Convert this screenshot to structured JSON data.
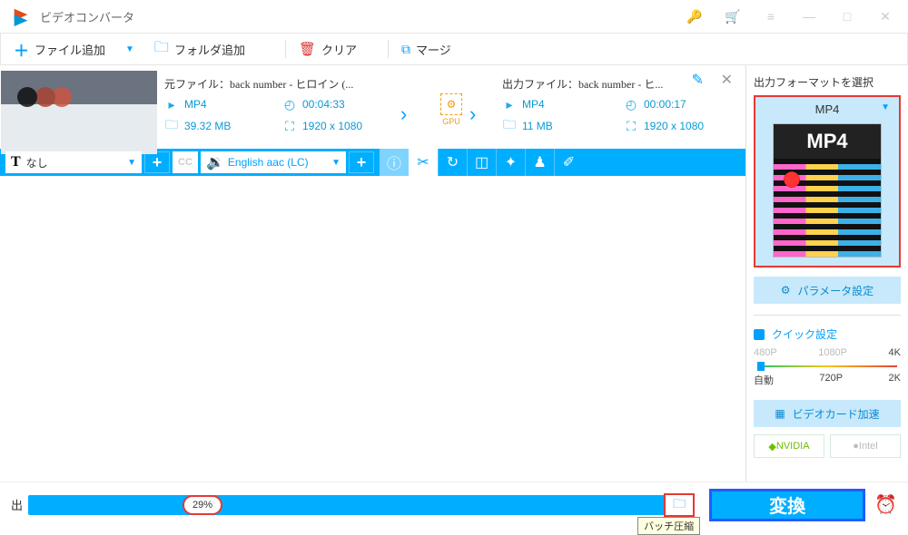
{
  "app": {
    "title": "ビデオコンバータ"
  },
  "toolbar": {
    "add_file": "ファイル追加",
    "add_folder": "フォルダ追加",
    "clear": "クリア",
    "merge": "マージ"
  },
  "item": {
    "source": {
      "label": "元ファイル：",
      "name": "back number - ヒロイン (...",
      "format": "MP4",
      "duration": "00:04:33",
      "size": "39.32 MB",
      "resolution": "1920 x 1080"
    },
    "output": {
      "label": "出力ファイル：",
      "name": "back number - ヒ...",
      "format": "MP4",
      "duration": "00:00:17",
      "size": "11 MB",
      "resolution": "1920 x 1080"
    },
    "gpu_label": "GPU"
  },
  "actionbar": {
    "text_dropdown": "なし",
    "cc": "CC",
    "lang": "English aac (LC)"
  },
  "sidebar": {
    "header": "出力フォーマットを選択",
    "format_name": "MP4",
    "format_badge": "MP4",
    "param_button": "パラメータ設定",
    "quick_label": "クイック設定",
    "res_top": {
      "r480": "480P",
      "r1080": "1080P",
      "r4k": "4K"
    },
    "res_bottom": {
      "auto": "自動",
      "r720": "720P",
      "r2k": "2K"
    },
    "gpu_button": "ビデオカード加速",
    "nvidia": "NVIDIA",
    "intel": "Intel"
  },
  "bottom": {
    "out_label": "出",
    "progress_pct": "29%",
    "batch_tooltip": "バッチ圧縮",
    "convert": "変換"
  }
}
